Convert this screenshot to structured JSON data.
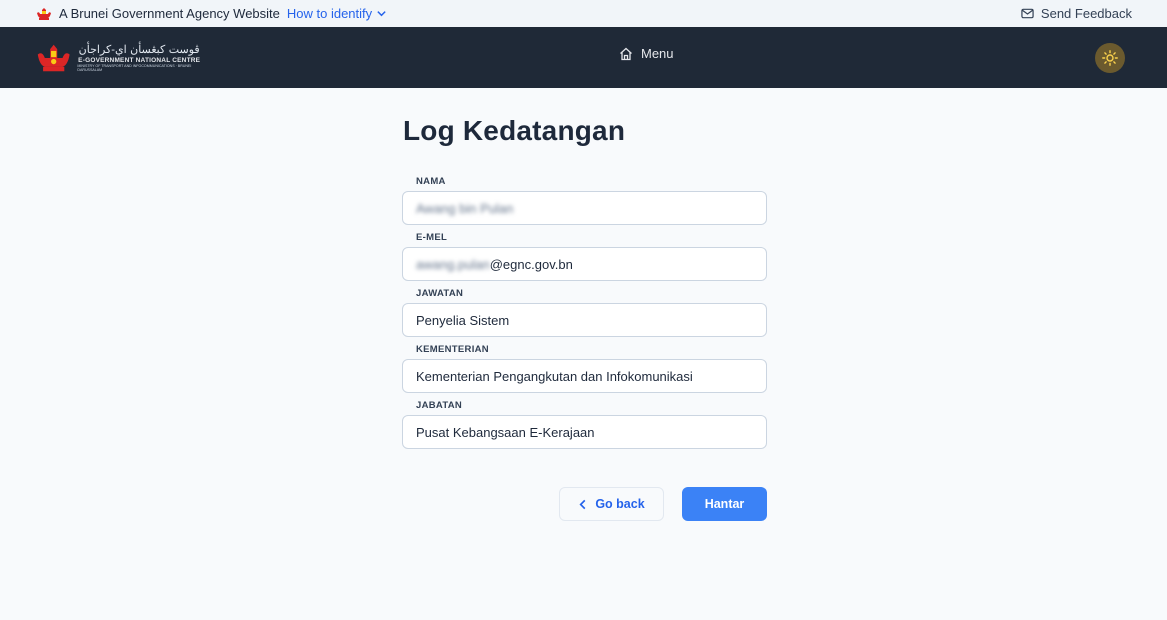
{
  "gov_strip": {
    "text": "A Brunei Government Agency Website",
    "identify_link": "How to identify",
    "feedback": "Send Feedback"
  },
  "navbar": {
    "logo_jawi": "ڤوست كبڠسأن اي-كراجأن",
    "logo_main": "E-GOVERNMENT NATIONAL CENTRE",
    "logo_sub": "MINISTRY OF TRANSPORT AND INFOCOMMUNICATIONS · BRUNEI DARUSSALAM",
    "menu_label": "Menu"
  },
  "form": {
    "title": "Log Kedatangan",
    "fields": [
      {
        "label": "NAMA",
        "value": "Awang bin Pulan"
      },
      {
        "label": "E-MEL",
        "value_blurred": "awang.pulan",
        "value_visible": "@egnc.gov.bn"
      },
      {
        "label": "JAWATAN",
        "value": "Penyelia Sistem"
      },
      {
        "label": "KEMENTERIAN",
        "value": "Kementerian Pengangkutan dan Infokomunikasi"
      },
      {
        "label": "JABATAN",
        "value": "Pusat Kebangsaan E-Kerajaan"
      }
    ],
    "back_label": "Go back",
    "submit_label": "Hantar"
  },
  "colors": {
    "navbar_bg": "#1f2937",
    "primary": "#3b82f6",
    "link": "#2563eb",
    "theme_button": "#6b5a2e"
  }
}
